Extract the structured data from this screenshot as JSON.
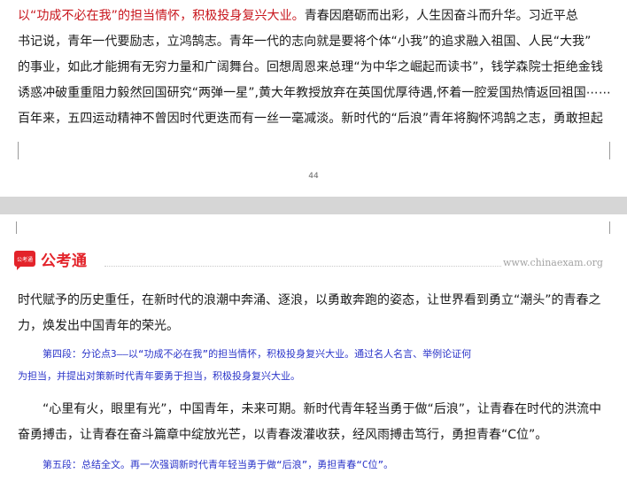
{
  "top_page": {
    "lines": [
      {
        "red": "以“功成不必在我”的担当情怀，积极投身复兴大业。",
        "rest": "青春因磨砺而出彩，人生因奋斗而升华。习近平总"
      },
      {
        "red": "",
        "rest": "书记说，青年一代要励志，立鸿鹄志。青年一代的志向就是要将个体“小我”的追求融入祖国、人民“大我”"
      },
      {
        "red": "",
        "rest": "的事业，如此才能拥有无穷力量和广阔舞台。回想周恩来总理“为中华之崛起而读书”，钱学森院士拒绝金钱"
      },
      {
        "red": "",
        "rest": "诱惑冲破重重阻力毅然回国研究“两弹一星”,黄大年教授放弃在英国优厚待遇,怀着一腔爱国热情返回祖国⋯⋯"
      },
      {
        "red": "",
        "rest": "百年来，五四运动精神不曾因时代更迭而有一丝一毫减淡。新时代的“后浪”青年将胸怀鸿鹄之志，勇敢担起"
      }
    ],
    "page_number": "44"
  },
  "header": {
    "logo_badge": "公考通",
    "logo_text": "公考通",
    "site": "www.chinaexam.org"
  },
  "bottom_page": {
    "para1_lines": [
      "时代赋予的历史重任，在新时代的浪潮中奔涌、逐浪，以勇敢奔跑的姿态，让世界看到勇立“潮头”的青春之",
      "力，焕发出中国青年的荣光。"
    ],
    "note1_lines": [
      "第四段：分论点3——以“功成不必在我”的担当情怀，积极投身复兴大业。通过名人名言、举例论证何",
      "为担当，并提出对策新时代青年要勇于担当，积极投身复兴大业。"
    ],
    "para2_lines": [
      "“心里有火，眼里有光”，中国青年，未来可期。新时代青年轻当勇于做“后浪”，让青春在时代的洪流中",
      "奋勇搏击，让青春在奋斗篇章中绽放光芒，以青春泼灌收获，经风雨搏击笃行，勇担青春“C位”。"
    ],
    "note2_lines": [
      "第五段：总结全文。再一次强调新时代青年轻当勇于做“后浪”，勇担青春“C位”。"
    ]
  },
  "colors": {
    "accent_red": "#c8161d",
    "note_blue": "#2b35c9",
    "gap_gray": "#d6d6d6"
  }
}
